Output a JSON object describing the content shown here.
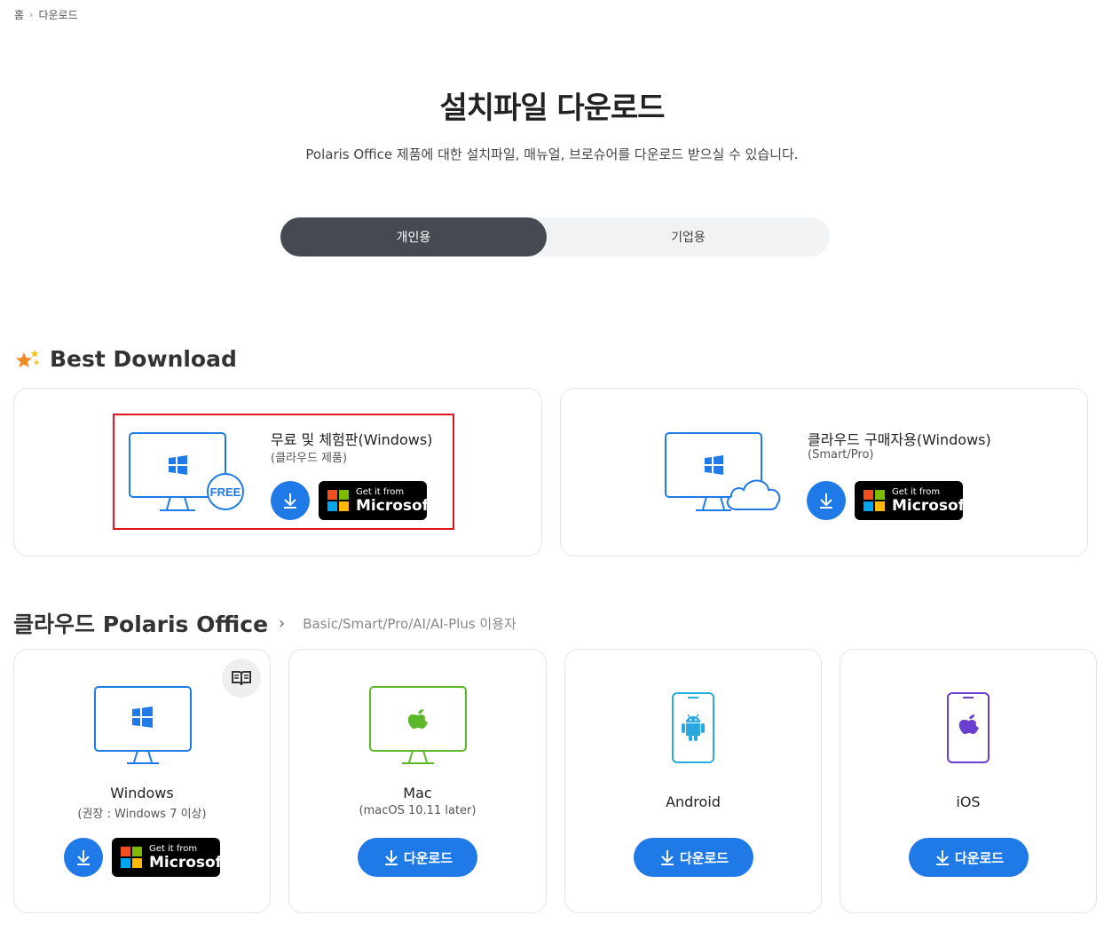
{
  "breadcrumb": {
    "home": "홈",
    "current": "다운로드"
  },
  "header": {
    "title": "설치파일 다운로드",
    "subtitle": "Polaris Office 제품에 대한 설치파일, 매뉴얼, 브로슈어를 다운로드 받으실 수 있습니다."
  },
  "toggle": {
    "personal": "개인용",
    "business": "기업용",
    "selected": "개인용"
  },
  "best": {
    "heading": "Best Download",
    "cards": [
      {
        "title": "무료 및 체험판(Windows)",
        "subtitle": "(클라우드 제품)",
        "badge": "FREE"
      },
      {
        "title": "클라우드 구매자용(Windows)",
        "subtitle": "(Smart/Pro)"
      }
    ]
  },
  "ms_store": {
    "small": "Get it from",
    "big": "Microsoft"
  },
  "cloud": {
    "heading": "클라우드 Polaris Office",
    "sub": "Basic/Smart/Pro/AI/AI-Plus 이용자",
    "products": [
      {
        "name": "Windows",
        "req": "(권장 : Windows 7 이상)"
      },
      {
        "name": "Mac",
        "req": "(macOS 10.11 later)",
        "button": "다운로드"
      },
      {
        "name": "Android",
        "button": "다운로드"
      },
      {
        "name": "iOS",
        "button": "다운로드"
      }
    ]
  },
  "colors": {
    "accent": "#1f7ae8",
    "dark": "#454a52",
    "highlight": "#e0141e",
    "mac_green": "#5cb82a",
    "ios_purple": "#6a3fd0"
  }
}
